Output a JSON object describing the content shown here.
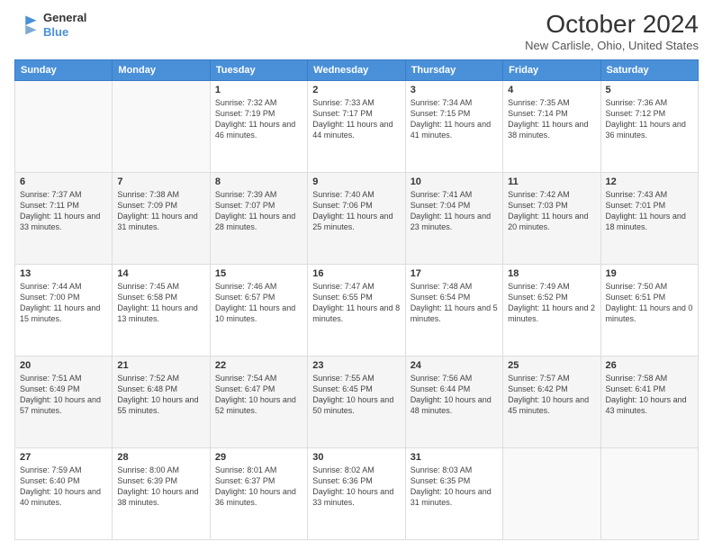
{
  "header": {
    "logo_line1": "General",
    "logo_line2": "Blue",
    "title": "October 2024",
    "subtitle": "New Carlisle, Ohio, United States"
  },
  "days_of_week": [
    "Sunday",
    "Monday",
    "Tuesday",
    "Wednesday",
    "Thursday",
    "Friday",
    "Saturday"
  ],
  "weeks": [
    [
      {
        "day": "",
        "info": ""
      },
      {
        "day": "",
        "info": ""
      },
      {
        "day": "1",
        "info": "Sunrise: 7:32 AM\nSunset: 7:19 PM\nDaylight: 11 hours and 46 minutes."
      },
      {
        "day": "2",
        "info": "Sunrise: 7:33 AM\nSunset: 7:17 PM\nDaylight: 11 hours and 44 minutes."
      },
      {
        "day": "3",
        "info": "Sunrise: 7:34 AM\nSunset: 7:15 PM\nDaylight: 11 hours and 41 minutes."
      },
      {
        "day": "4",
        "info": "Sunrise: 7:35 AM\nSunset: 7:14 PM\nDaylight: 11 hours and 38 minutes."
      },
      {
        "day": "5",
        "info": "Sunrise: 7:36 AM\nSunset: 7:12 PM\nDaylight: 11 hours and 36 minutes."
      }
    ],
    [
      {
        "day": "6",
        "info": "Sunrise: 7:37 AM\nSunset: 7:11 PM\nDaylight: 11 hours and 33 minutes."
      },
      {
        "day": "7",
        "info": "Sunrise: 7:38 AM\nSunset: 7:09 PM\nDaylight: 11 hours and 31 minutes."
      },
      {
        "day": "8",
        "info": "Sunrise: 7:39 AM\nSunset: 7:07 PM\nDaylight: 11 hours and 28 minutes."
      },
      {
        "day": "9",
        "info": "Sunrise: 7:40 AM\nSunset: 7:06 PM\nDaylight: 11 hours and 25 minutes."
      },
      {
        "day": "10",
        "info": "Sunrise: 7:41 AM\nSunset: 7:04 PM\nDaylight: 11 hours and 23 minutes."
      },
      {
        "day": "11",
        "info": "Sunrise: 7:42 AM\nSunset: 7:03 PM\nDaylight: 11 hours and 20 minutes."
      },
      {
        "day": "12",
        "info": "Sunrise: 7:43 AM\nSunset: 7:01 PM\nDaylight: 11 hours and 18 minutes."
      }
    ],
    [
      {
        "day": "13",
        "info": "Sunrise: 7:44 AM\nSunset: 7:00 PM\nDaylight: 11 hours and 15 minutes."
      },
      {
        "day": "14",
        "info": "Sunrise: 7:45 AM\nSunset: 6:58 PM\nDaylight: 11 hours and 13 minutes."
      },
      {
        "day": "15",
        "info": "Sunrise: 7:46 AM\nSunset: 6:57 PM\nDaylight: 11 hours and 10 minutes."
      },
      {
        "day": "16",
        "info": "Sunrise: 7:47 AM\nSunset: 6:55 PM\nDaylight: 11 hours and 8 minutes."
      },
      {
        "day": "17",
        "info": "Sunrise: 7:48 AM\nSunset: 6:54 PM\nDaylight: 11 hours and 5 minutes."
      },
      {
        "day": "18",
        "info": "Sunrise: 7:49 AM\nSunset: 6:52 PM\nDaylight: 11 hours and 2 minutes."
      },
      {
        "day": "19",
        "info": "Sunrise: 7:50 AM\nSunset: 6:51 PM\nDaylight: 11 hours and 0 minutes."
      }
    ],
    [
      {
        "day": "20",
        "info": "Sunrise: 7:51 AM\nSunset: 6:49 PM\nDaylight: 10 hours and 57 minutes."
      },
      {
        "day": "21",
        "info": "Sunrise: 7:52 AM\nSunset: 6:48 PM\nDaylight: 10 hours and 55 minutes."
      },
      {
        "day": "22",
        "info": "Sunrise: 7:54 AM\nSunset: 6:47 PM\nDaylight: 10 hours and 52 minutes."
      },
      {
        "day": "23",
        "info": "Sunrise: 7:55 AM\nSunset: 6:45 PM\nDaylight: 10 hours and 50 minutes."
      },
      {
        "day": "24",
        "info": "Sunrise: 7:56 AM\nSunset: 6:44 PM\nDaylight: 10 hours and 48 minutes."
      },
      {
        "day": "25",
        "info": "Sunrise: 7:57 AM\nSunset: 6:42 PM\nDaylight: 10 hours and 45 minutes."
      },
      {
        "day": "26",
        "info": "Sunrise: 7:58 AM\nSunset: 6:41 PM\nDaylight: 10 hours and 43 minutes."
      }
    ],
    [
      {
        "day": "27",
        "info": "Sunrise: 7:59 AM\nSunset: 6:40 PM\nDaylight: 10 hours and 40 minutes."
      },
      {
        "day": "28",
        "info": "Sunrise: 8:00 AM\nSunset: 6:39 PM\nDaylight: 10 hours and 38 minutes."
      },
      {
        "day": "29",
        "info": "Sunrise: 8:01 AM\nSunset: 6:37 PM\nDaylight: 10 hours and 36 minutes."
      },
      {
        "day": "30",
        "info": "Sunrise: 8:02 AM\nSunset: 6:36 PM\nDaylight: 10 hours and 33 minutes."
      },
      {
        "day": "31",
        "info": "Sunrise: 8:03 AM\nSunset: 6:35 PM\nDaylight: 10 hours and 31 minutes."
      },
      {
        "day": "",
        "info": ""
      },
      {
        "day": "",
        "info": ""
      }
    ]
  ]
}
